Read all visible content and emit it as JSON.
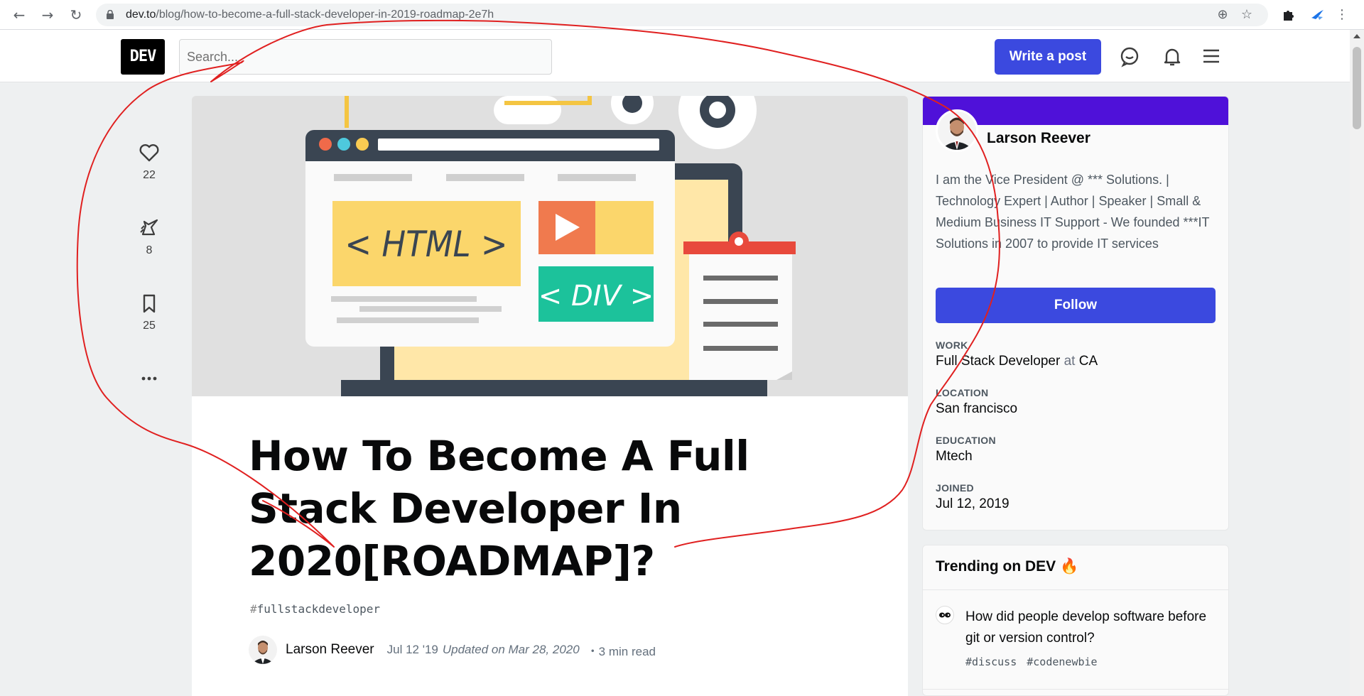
{
  "browser": {
    "url_host": "dev.to",
    "url_path": "/blog/how-to-become-a-full-stack-developer-in-2019-roadmap-2e7h"
  },
  "header": {
    "logo": "DEV",
    "search_placeholder": "Search...",
    "write_post_label": "Write a post"
  },
  "reactions": {
    "likes": "22",
    "unicorns": "8",
    "bookmarks": "25",
    "more": "..."
  },
  "article": {
    "title": "How To Become A Full Stack Developer In 2020[ROADMAP]?",
    "tag": "fullstackdeveloper",
    "author": "Larson Reever",
    "date": "Jul 12 '19",
    "updated": "Updated on Mar 28, 2020",
    "read_time": "・3 min read",
    "cover": {
      "html_label": "< HTML >",
      "div_label": "< DIV >"
    }
  },
  "profile": {
    "name": "Larson Reever",
    "bio": "I am the Vice President @ *** Solutions. | Technology Expert | Author | Speaker | Small & Medium Business IT Support - We founded ***IT Solutions in 2007 to provide IT services",
    "follow_label": "Follow",
    "work_label": "WORK",
    "work_value": "Full Stack Developer",
    "work_at": "at",
    "work_company": "CA",
    "location_label": "LOCATION",
    "location_value": "San francisco",
    "education_label": "EDUCATION",
    "education_value": "Mtech",
    "joined_label": "JOINED",
    "joined_value": "Jul 12, 2019"
  },
  "trending": {
    "heading": "Trending on DEV 🔥",
    "posts": [
      {
        "title": "How did people develop software before git or version control?",
        "tags": [
          "#discuss",
          "#codenewbie"
        ]
      }
    ]
  },
  "colors": {
    "accent": "#3b49df",
    "brand_band": "#4f11d9",
    "annotation": "#e02020"
  }
}
